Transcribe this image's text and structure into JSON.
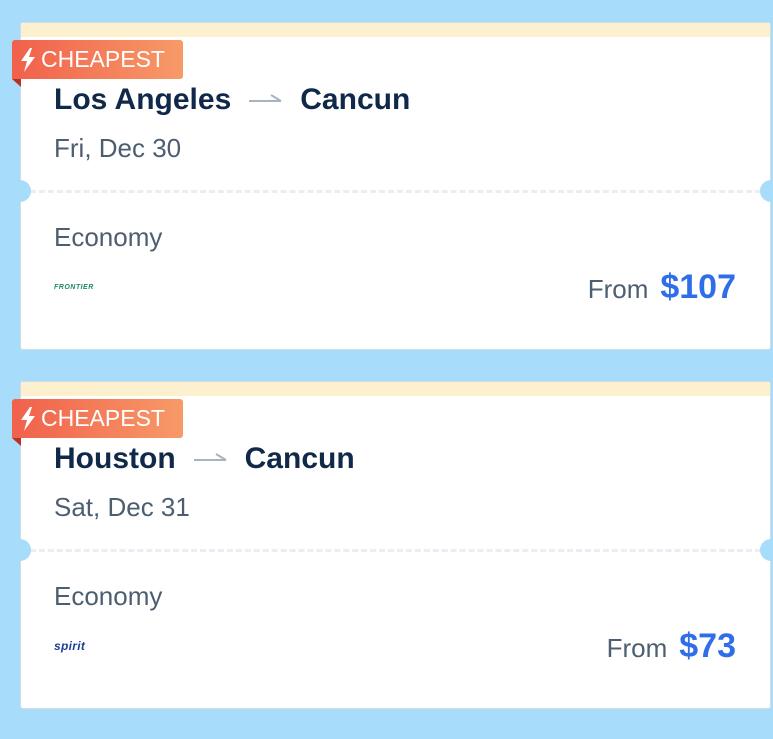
{
  "page": {
    "background_color": "#a8dcfb",
    "accent_color": "#2f6ee8"
  },
  "flights": [
    {
      "badge": {
        "icon": "lightning-bolt-icon",
        "label": "CHEAPEST"
      },
      "origin": "Los Angeles",
      "destination": "Cancun",
      "route_arrow_icon": "arrow-right-icon",
      "date": "Fri, Dec 30",
      "cabin": "Economy",
      "airline_logo_text": "FRONTIER",
      "price_prefix": "From",
      "price": "$107"
    },
    {
      "badge": {
        "icon": "lightning-bolt-icon",
        "label": "CHEAPEST"
      },
      "origin": "Houston",
      "destination": "Cancun",
      "route_arrow_icon": "arrow-right-icon",
      "date": "Sat, Dec 31",
      "cabin": "Economy",
      "airline_logo_text": "spirit",
      "price_prefix": "From",
      "price": "$73"
    }
  ]
}
